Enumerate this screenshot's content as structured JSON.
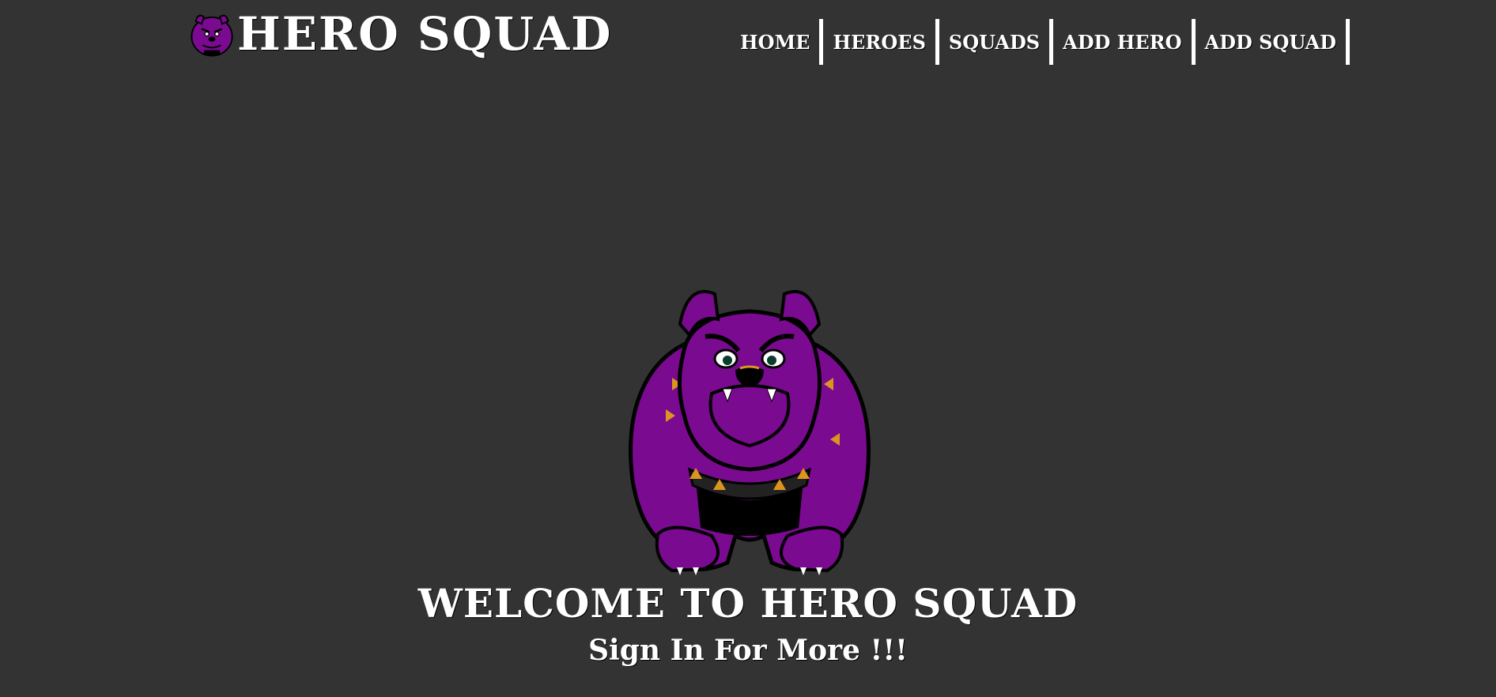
{
  "brand": {
    "title": "HERO SQUAD",
    "logo_icon": "bulldog-logo-icon"
  },
  "nav": {
    "items": [
      {
        "label": "HOME"
      },
      {
        "label": "HEROES"
      },
      {
        "label": "SQUADS"
      },
      {
        "label": "ADD HERO"
      },
      {
        "label": "ADD SQUAD"
      }
    ]
  },
  "main": {
    "mascot_icon": "purple-bulldog-mascot",
    "heading": "WELCOME TO HERO SQUAD",
    "subheading": "Sign In For More !!!"
  },
  "colors": {
    "background": "#333333",
    "text": "#ffffff",
    "mascot_purple": "#7a0a8f",
    "spike_gold": "#d9951f"
  }
}
